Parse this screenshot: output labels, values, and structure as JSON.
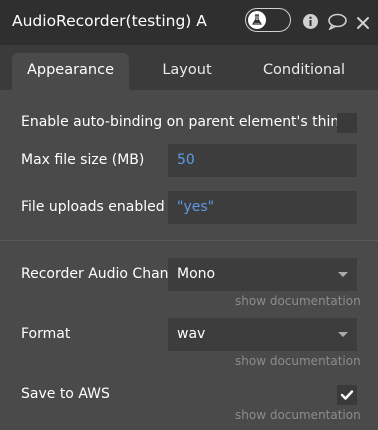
{
  "header": {
    "title": "AudioRecorder(testing) A",
    "icons": [
      "flask-icon",
      "info-icon",
      "comment-icon",
      "close-icon"
    ]
  },
  "tabs": [
    {
      "label": "Appearance",
      "active": true
    },
    {
      "label": "Layout",
      "active": false
    },
    {
      "label": "Conditional",
      "active": false
    }
  ],
  "properties": {
    "auto_binding": {
      "label": "Enable auto-binding on parent element's thing",
      "checked": false
    },
    "max_file_size": {
      "label": "Max file size (MB)",
      "value": "50"
    },
    "file_uploads": {
      "label": "File uploads enabled",
      "value": "\"yes\""
    },
    "audio_channel": {
      "label": "Recorder Audio Chan",
      "value": "Mono",
      "doc_link": "show documentation"
    },
    "format": {
      "label": "Format",
      "value": "wav",
      "doc_link": "show documentation"
    },
    "save_to_aws": {
      "label": "Save to AWS",
      "checked": true,
      "doc_link": "show documentation"
    }
  },
  "colors": {
    "background": "#4a4a4a",
    "header": "#2f2f2f",
    "field": "#3d3d3d",
    "value_blue": "#5f9be6",
    "doc_link": "#8c8c8c"
  }
}
